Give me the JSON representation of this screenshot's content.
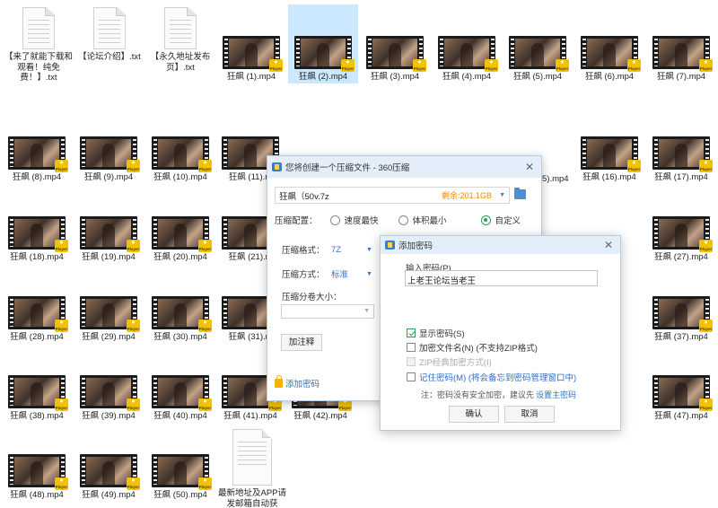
{
  "files_row1": [
    {
      "type": "txt",
      "label": "【来了就能下载和观看！纯免费！】.txt"
    },
    {
      "type": "txt",
      "label": "【论坛介绍】.txt"
    },
    {
      "type": "txt",
      "label": "【永久地址发布页】.txt"
    },
    {
      "type": "video",
      "label": "狂飙 (1).mp4"
    },
    {
      "type": "video",
      "label": "狂飙 (2).mp4",
      "selected": true
    },
    {
      "type": "video",
      "label": "狂飙 (3).mp4"
    },
    {
      "type": "video",
      "label": "狂飙 (4).mp4"
    },
    {
      "type": "video",
      "label": "狂飙 (5).mp4"
    },
    {
      "type": "video",
      "label": "狂飙 (6).mp4"
    },
    {
      "type": "video",
      "label": "狂飙 (7).mp4"
    }
  ],
  "files_row2": [
    "狂飙 (8).mp4",
    "狂飙 (9).mp4",
    "狂飙 (10).mp4",
    "狂飙 (11).m",
    "狂飙 (16).mp4",
    "狂飙 (17).mp4"
  ],
  "files_row3": [
    "狂飙 (18).mp4",
    "狂飙 (19).mp4",
    "狂飙 (20).mp4",
    "狂飙 (21).m",
    "狂飙 (27).mp4"
  ],
  "files_row4": [
    "狂飙 (28).mp4",
    "狂飙 (29).mp4",
    "狂飙 (30).mp4",
    "狂飙 (31).m",
    "狂飙 (37).mp4"
  ],
  "files_row5": [
    "狂飙 (38).mp4",
    "狂飙 (39).mp4",
    "狂飙 (40).mp4",
    "狂飙 (41).mp4",
    "狂飙 (42).mp4",
    "狂飙 (47).mp4"
  ],
  "files_row6": [
    {
      "type": "video",
      "label": "狂飙 (48).mp4"
    },
    {
      "type": "video",
      "label": "狂飙 (49).mp4"
    },
    {
      "type": "video",
      "label": "狂飙 (50).mp4"
    },
    {
      "type": "txt",
      "label": "最新地址及APP请发邮箱自动获"
    }
  ],
  "video_badge": "Player",
  "compress_dialog": {
    "title": "您将创建一个压缩文件 - 360压缩",
    "close": "✕",
    "path_value": "狂飙（50v.7z",
    "free_space": "剩余:201.1GB",
    "config_label": "压缩配置：",
    "options": [
      {
        "label": "速度最快",
        "checked": false
      },
      {
        "label": "体积最小",
        "checked": false
      },
      {
        "label": "自定义",
        "checked": true
      }
    ],
    "format_label": "压缩格式：",
    "format_value": "7Z",
    "method_label": "压缩方式：",
    "method_value": "标准",
    "volume_label": "压缩分卷大小：",
    "volume_value": "",
    "comment_button": "加注释",
    "add_password": "添加密码",
    "peek_labels": [
      "5).mp4"
    ]
  },
  "password_dialog": {
    "title": "添加密码",
    "close": "✕",
    "input_label": "输入密码(P)",
    "input_value": "上老王论坛当老王",
    "show_password": {
      "label": "显示密码(S)",
      "checked": true
    },
    "encrypt_names": {
      "label": "加密文件名(N) (不支持ZIP格式)",
      "checked": false
    },
    "zip_classic": {
      "label": "ZIP经典加密方式(I)",
      "checked": false
    },
    "remember": {
      "label": "记住密码(M) (将会备忘到密码管理窗口中)",
      "checked": false
    },
    "note": "注：密码没有安全加密，建议先",
    "note_link": "设置主密码",
    "ok": "确认",
    "cancel": "取消"
  },
  "colors": {
    "accent": "#2f9b5a",
    "link": "#2f6fc8",
    "selection": "#cce8ff",
    "titlebar": "#e3eefa",
    "badge": "#f2c200"
  }
}
